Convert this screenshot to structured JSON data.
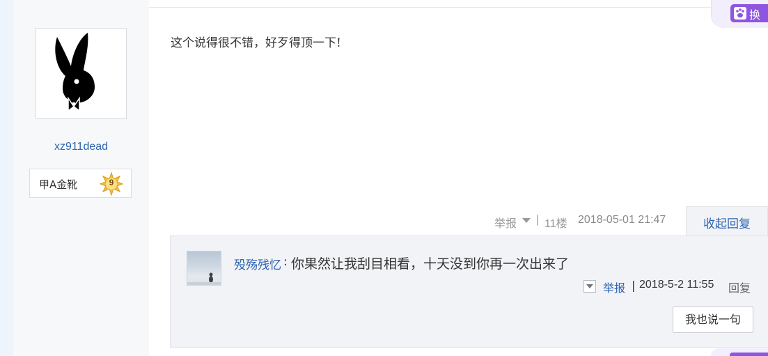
{
  "author": {
    "username": "xz911dead",
    "badge_label": "甲A金靴",
    "badge_level": "9"
  },
  "post": {
    "text": "这个说得很不错，好歹得顶一下!",
    "report": "举报",
    "separator": "|",
    "floor": "11楼",
    "timestamp": "2018-05-01 21:47",
    "collapse_replies": "收起回复"
  },
  "reply": {
    "author": "殁殇残忆",
    "colon": ":",
    "text": "你果然让我刮目相看，十天没到你再一次出来了",
    "report": "举报",
    "separator": "|",
    "timestamp": "2018-5-2 11:55",
    "reply_label": "回复"
  },
  "say_button": "我也说一句",
  "corner": {
    "swap_label": "换"
  },
  "colors": {
    "link_blue": "#2d64b3",
    "author_bg": "#f7f8fa",
    "reply_bg": "#f2f3f6",
    "accent_purple": "#8e55e0"
  },
  "icons": [
    "playboy-bunny-avatar",
    "level-star-badge-icon",
    "dropdown-caret-icon",
    "paw-icon"
  ]
}
